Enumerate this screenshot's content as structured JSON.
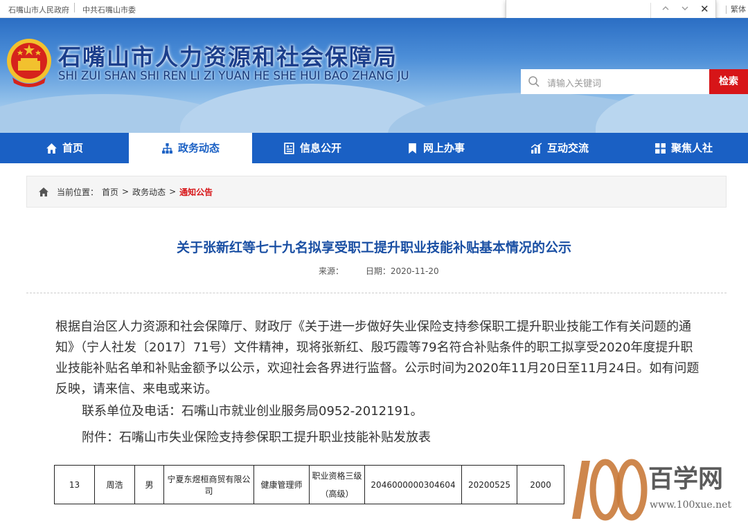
{
  "topbar": {
    "link1": "石嘴山市人民政府",
    "link2": "中共石嘴山市委",
    "traditional": "繁体"
  },
  "findbar": {
    "up_icon": "chevron-up-icon",
    "down_icon": "chevron-down-icon",
    "close": "✕"
  },
  "site": {
    "title": "石嘴山市人力资源和社会保障局",
    "pinyin": "SHI ZUI SHAN SHI REN LI ZI YUAN HE SHE HUI BAO ZHANG JU"
  },
  "search": {
    "placeholder": "请输入关键词",
    "button": "检索"
  },
  "nav": [
    {
      "label": "首页",
      "icon": "home-icon"
    },
    {
      "label": "政务动态",
      "icon": "sitemap-icon"
    },
    {
      "label": "信息公开",
      "icon": "document-icon"
    },
    {
      "label": "网上办事",
      "icon": "bookmark-icon"
    },
    {
      "label": "互动交流",
      "icon": "chart-icon"
    },
    {
      "label": "聚焦人社",
      "icon": "grid-icon"
    }
  ],
  "breadcrumb": {
    "prefix": "当前位置：",
    "home": "首页",
    "sep": ">",
    "section": "政务动态",
    "current": "通知公告"
  },
  "article": {
    "title": "关于张新红等七十九名拟享受职工提升职业技能补贴基本情况的公示",
    "source_label": "来源：",
    "date_label": "日期：2020-11-20",
    "paragraph1": "根据自治区人力资源和社会保障厅、财政厅《关于进一步做好失业保险支持参保职工提升职业技能工作有关问题的通知》（宁人社发〔2017〕71号）文件精神，现将张新红、殷巧霞等79名符合补贴条件的职工拟享受2020年度提升职业技能补贴名单和补贴金额予以公示，欢迎社会各界进行监督。公示时间为2020年11月20日至11月24日。如有问题反映，请来信、来电或来访。",
    "contact": "联系单位及电话：石嘴山市就业创业服务局0952-2012191。",
    "attachment": "附件：石嘴山市失业保险支持参保职工提升职业技能补贴发放表"
  },
  "table_row": {
    "no": "13",
    "name": "周浩",
    "gender": "男",
    "company": "宁夏东煜桓商贸有限公司",
    "job": "健康管理师",
    "qual_line1": "职业资格三级",
    "qual_line2": "（高级）",
    "cert": "2046000000304604",
    "date": "20200525",
    "amount": "2000"
  },
  "watermark": {
    "text": "百学网",
    "url": "www.100xue.net"
  },
  "colors": {
    "nav": "#1a60c4",
    "accent": "#d71518",
    "title": "#1a4fa3"
  }
}
